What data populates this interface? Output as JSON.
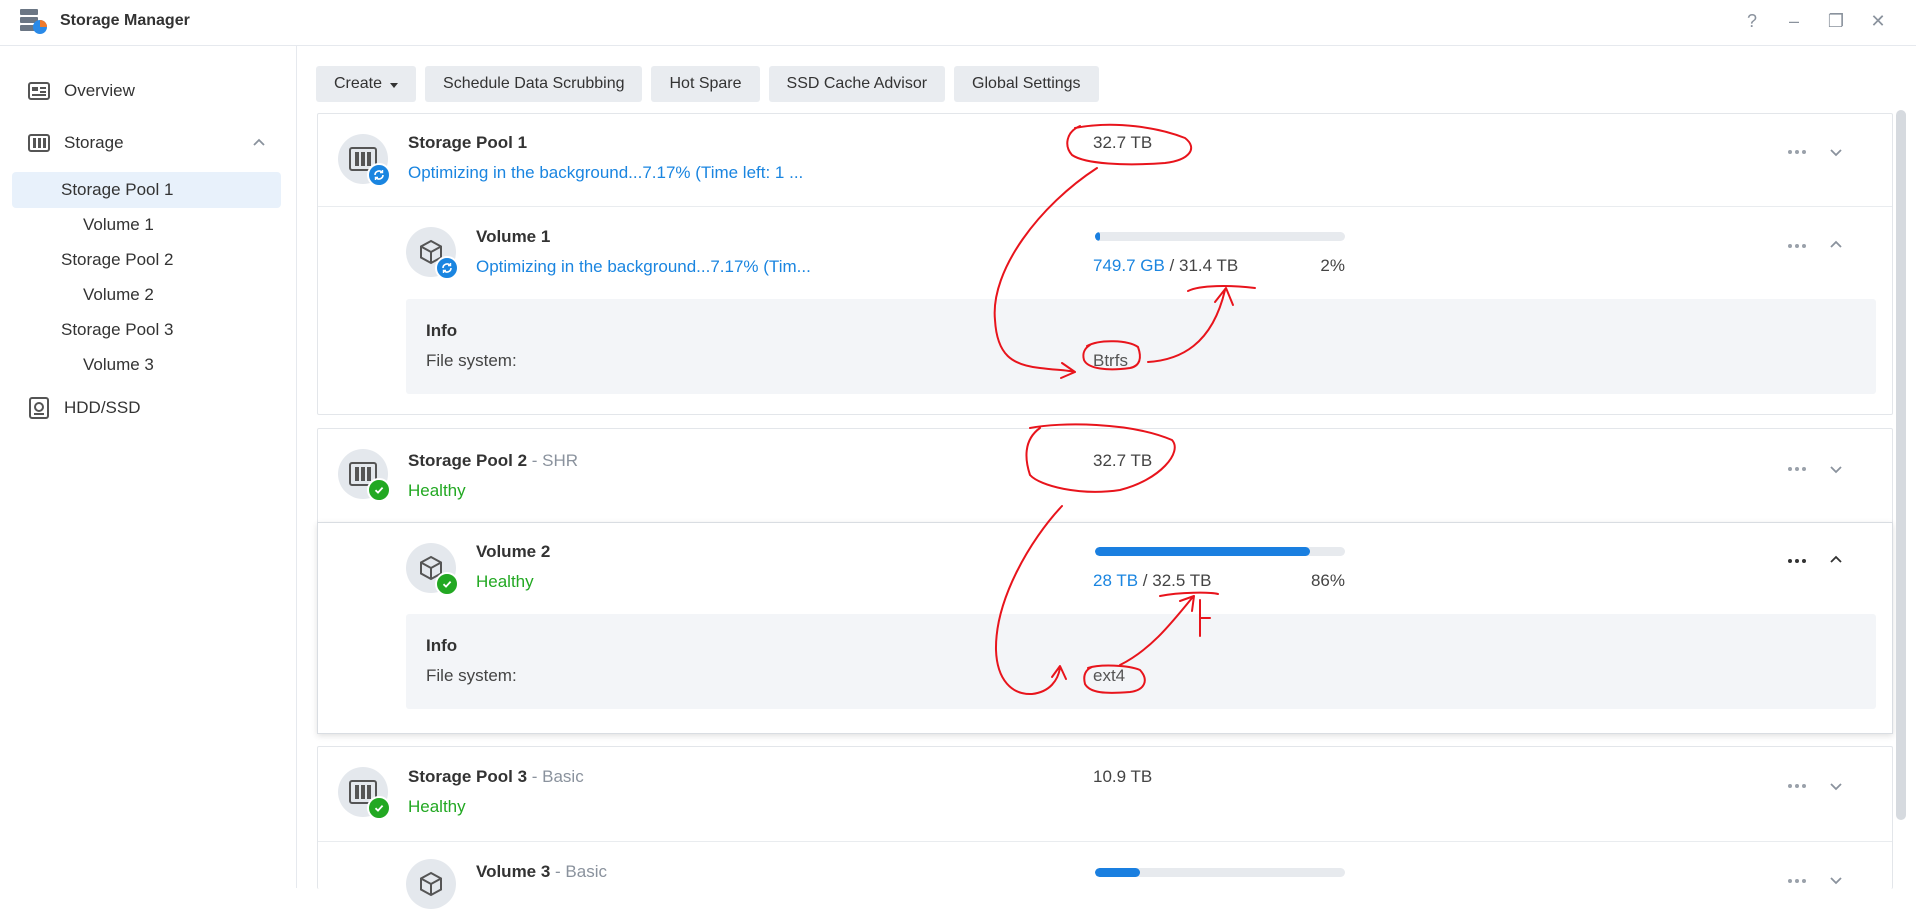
{
  "window": {
    "title": "Storage Manager",
    "buttons": [
      "?",
      "–",
      "❐",
      "✕"
    ]
  },
  "sidebar": {
    "overview": "Overview",
    "storage": "Storage",
    "pool1": "Storage Pool 1",
    "vol1": "Volume 1",
    "pool2": "Storage Pool 2",
    "vol2": "Volume 2",
    "pool3": "Storage Pool 3",
    "vol3": "Volume 3",
    "hdd": "HDD/SSD"
  },
  "toolbar": {
    "create": "Create",
    "scrub": "Schedule Data Scrubbing",
    "hotspare": "Hot Spare",
    "ssd": "SSD Cache Advisor",
    "global": "Global Settings"
  },
  "pools": [
    {
      "name": "Storage Pool 1",
      "type": "",
      "status": "Optimizing in the background...7.17% (Time left: 1 ...",
      "size": "32.7 TB",
      "volume": {
        "name": "Volume 1",
        "type": "",
        "status": "Optimizing in the background...7.17% (Tim...",
        "used": "749.7 GB",
        "sep": " / ",
        "total": "31.4 TB",
        "percent": "2%",
        "usage_fraction": 0.02,
        "info_title": "Info",
        "fs_label": "File system:",
        "fs_value": "Btrfs"
      }
    },
    {
      "name": "Storage Pool 2",
      "type": " - SHR",
      "status": "Healthy",
      "size": "32.7 TB",
      "volume": {
        "name": "Volume 2",
        "type": "",
        "status": "Healthy",
        "used": "28 TB",
        "sep": " / ",
        "total": "32.5 TB",
        "percent": "86%",
        "usage_fraction": 0.86,
        "info_title": "Info",
        "fs_label": "File system:",
        "fs_value": "ext4"
      }
    },
    {
      "name": "Storage Pool 3",
      "type": " - Basic",
      "status": "Healthy",
      "size": "10.9 TB",
      "volume": {
        "name": "Volume 3",
        "type": " - Basic",
        "usage_fraction": 0.18
      }
    }
  ],
  "colors": {
    "accent": "#1a85e0",
    "healthy": "#22a822",
    "annotation": "#e8141c"
  }
}
